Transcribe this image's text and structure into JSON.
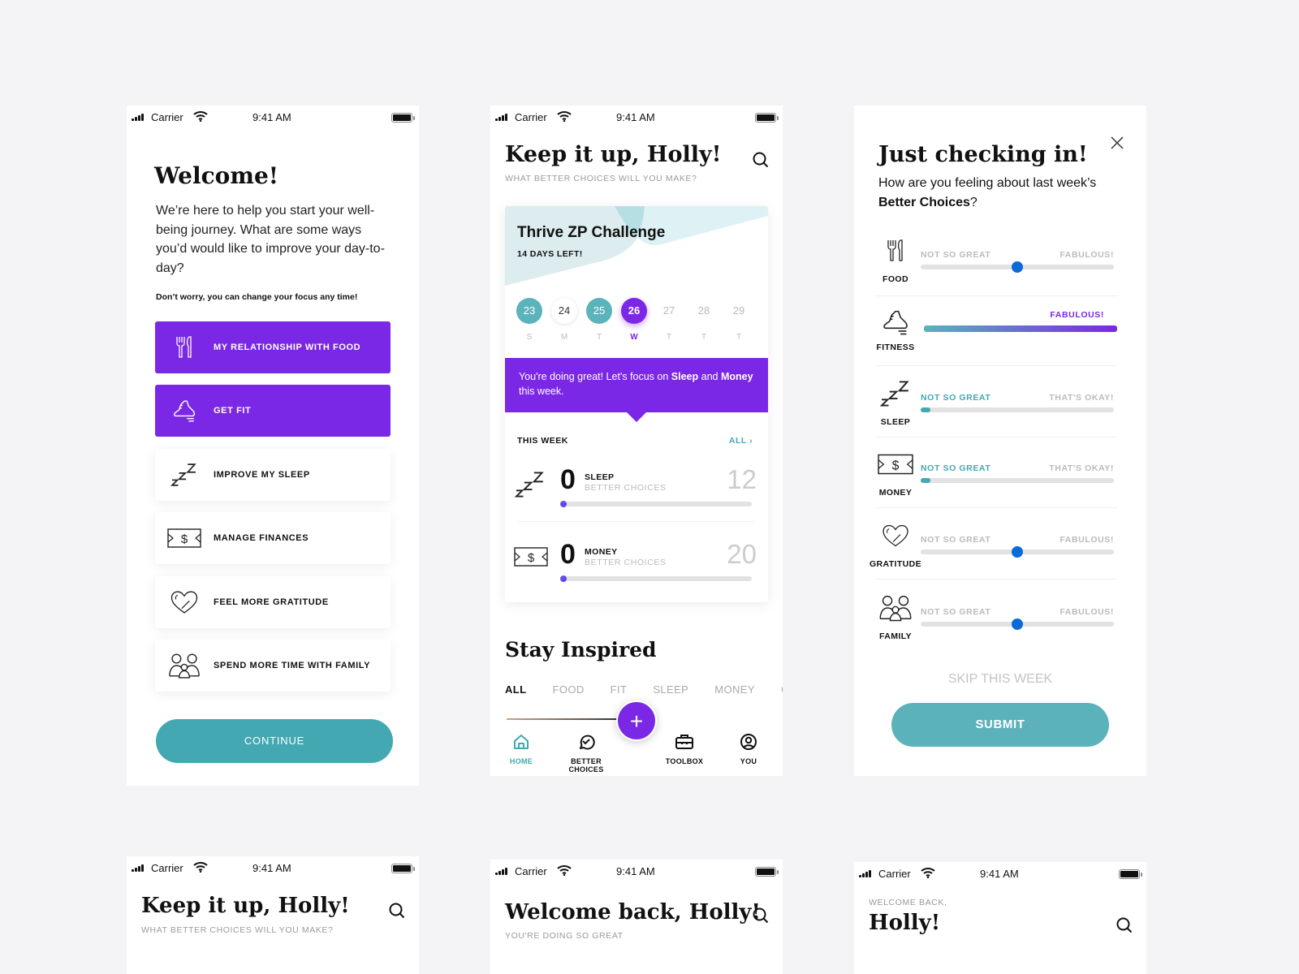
{
  "status_bar": {
    "carrier": "Carrier",
    "time": "9:41 AM"
  },
  "colors": {
    "purple": "#7b27e6",
    "teal": "#43a8b2",
    "slider_blue": "#0b6ad8",
    "background": "#f4f4f6"
  },
  "welcome": {
    "title": "Welcome!",
    "intro": "We’re here to help you start your well-being journey. What are some ways you’d would like to improve your day-to-day?",
    "note": "Don’t worry, you can change your focus any time!",
    "options": [
      {
        "label": "MY RELATIONSHIP WITH FOOD",
        "icon": "fork-knife-icon",
        "selected": true
      },
      {
        "label": "GET FIT",
        "icon": "sneaker-icon",
        "selected": true
      },
      {
        "label": "IMPROVE MY SLEEP",
        "icon": "zzz-icon",
        "selected": false
      },
      {
        "label": "MANAGE FINANCES",
        "icon": "dollar-bill-icon",
        "selected": false
      },
      {
        "label": "FEEL MORE GRATITUDE",
        "icon": "heart-icon",
        "selected": false
      },
      {
        "label": "SPEND MORE TIME WITH FAMILY",
        "icon": "family-icon",
        "selected": false
      }
    ],
    "continue_label": "CONTINUE"
  },
  "home": {
    "title": "Keep it up, Holly!",
    "subtitle": "WHAT BETTER CHOICES WILL YOU MAKE?",
    "challenge": {
      "title": "Thrive ZP Challenge",
      "days_left": "14 DAYS LEFT!",
      "calendar": [
        {
          "date": "23",
          "day": "S",
          "state": "done"
        },
        {
          "date": "24",
          "day": "M",
          "state": "open"
        },
        {
          "date": "25",
          "day": "T",
          "state": "done"
        },
        {
          "date": "26",
          "day": "W",
          "state": "current"
        },
        {
          "date": "27",
          "day": "T",
          "state": "future"
        },
        {
          "date": "28",
          "day": "T",
          "state": "future"
        },
        {
          "date": "29",
          "day": "T",
          "state": "future"
        }
      ],
      "banner_pre": "You're doing great! Let's focus on ",
      "banner_b1": "Sleep",
      "banner_mid": " and ",
      "banner_b2": "Money",
      "banner_post": " this week.",
      "this_week": "THIS WEEK",
      "all_link": "ALL ›",
      "progress": [
        {
          "name": "SLEEP",
          "caption": "BETTER CHOICES",
          "count": "0",
          "goal": "12",
          "fraction": 0
        },
        {
          "name": "MONEY",
          "caption": "BETTER CHOICES",
          "count": "0",
          "goal": "20",
          "fraction": 0
        }
      ]
    },
    "inspired_title": "Stay Inspired",
    "filters": [
      "ALL",
      "FOOD",
      "FIT",
      "SLEEP",
      "MONEY",
      "GRATITUDE"
    ],
    "fab_label": "+",
    "tabs": [
      {
        "label": "HOME",
        "active": true
      },
      {
        "label": "BETTER CHOICES",
        "active": false
      },
      {
        "label": "TOOLBOX",
        "active": false
      },
      {
        "label": "YOU",
        "active": false
      }
    ]
  },
  "checkin": {
    "title": "Just checking in!",
    "question_pre": "How are you feeling about last week’s ",
    "question_bold": "Better Choices",
    "question_post": "?",
    "ratings": [
      {
        "name": "FOOD",
        "low": "NOT SO GREAT",
        "high": "FABULOUS!",
        "value": 0.5,
        "style": "knob"
      },
      {
        "name": "FITNESS",
        "low": "",
        "high": "FABULOUS!",
        "value": 1.0,
        "style": "gradient"
      },
      {
        "name": "SLEEP",
        "low": "NOT SO GREAT",
        "high": "THAT'S OKAY!",
        "value": 0.05,
        "style": "low"
      },
      {
        "name": "MONEY",
        "low": "NOT SO GREAT",
        "high": "THAT'S OKAY!",
        "value": 0.05,
        "style": "low"
      },
      {
        "name": "GRATITUDE",
        "low": "NOT SO GREAT",
        "high": "FABULOUS!",
        "value": 0.5,
        "style": "knob"
      },
      {
        "name": "FAMILY",
        "low": "NOT SO GREAT",
        "high": "FABULOUS!",
        "value": 0.5,
        "style": "knob"
      }
    ],
    "skip_label": "SKIP THIS WEEK",
    "submit_label": "SUBMIT"
  },
  "preview_a": {
    "title": "Keep it up, Holly!",
    "subtitle": "WHAT BETTER CHOICES WILL YOU MAKE?"
  },
  "preview_b": {
    "title": "Welcome back, Holly!",
    "subtitle": "YOU'RE DOING SO GREAT"
  },
  "preview_c": {
    "pre": "WELCOME BACK,",
    "title": "Holly!"
  }
}
